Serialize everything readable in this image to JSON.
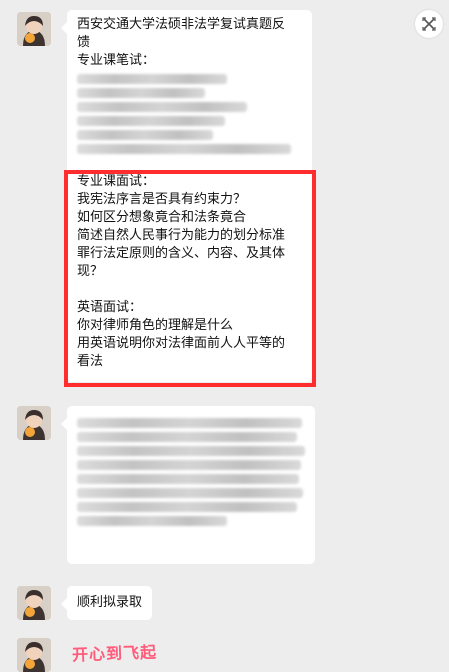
{
  "messages": [
    {
      "lines": [
        "西安交通大学法硕非法学复试真题反",
        "馈",
        "专业课笔试："
      ],
      "blurred_line_count": 6,
      "highlighted_lines": [
        "专业课面试：",
        "我宪法序言是否具有约束力？",
        "如何区分想象竟合和法条竟合",
        "简述自然人民事行为能力的划分标准",
        "罪行法定原则的含义、内容、及其体",
        "现？",
        "",
        "英语面试：",
        "你对律师角色的理解是什么",
        "用英语说明你对法律面前人人平等的",
        "看法"
      ]
    },
    {
      "blurred_line_count": 8
    },
    {
      "text": "顺利拟录取"
    },
    {
      "sticker_text": "开心到飞起"
    }
  ],
  "colors": {
    "background": "#ededed",
    "highlight_border": "#ff2d2d",
    "sticker": "#ff5b7a"
  }
}
